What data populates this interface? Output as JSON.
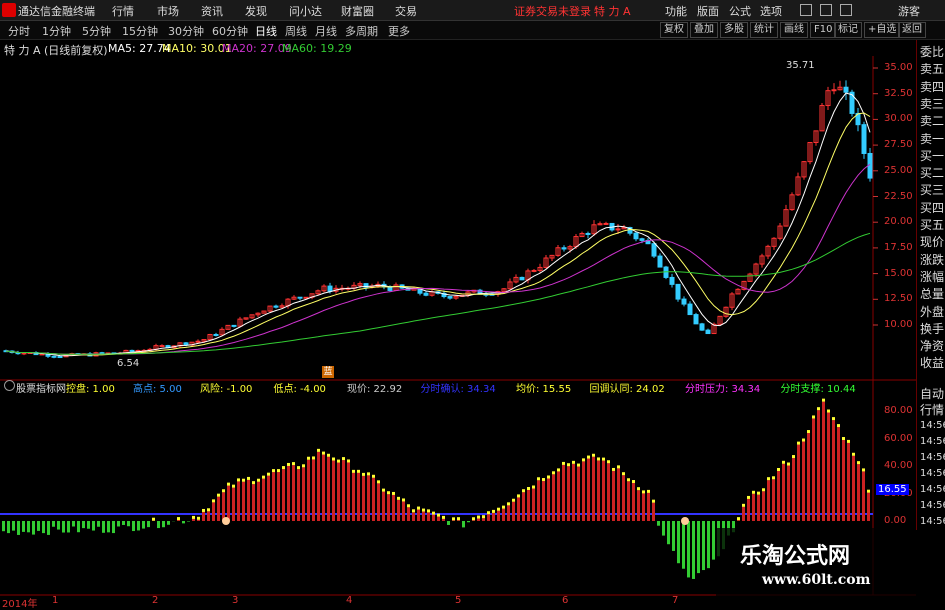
{
  "menubar": {
    "app_title": "通达信金融终端",
    "items": [
      "行情",
      "市场",
      "资讯",
      "发现",
      "问小达",
      "财富圈",
      "交易"
    ],
    "login_status": "证券交易未登录",
    "stock_name": "特 力 A",
    "right_items": [
      "功能",
      "版面",
      "公式",
      "选项"
    ],
    "guest": "游客"
  },
  "periodbar": {
    "periods": [
      "分时",
      "1分钟",
      "5分钟",
      "15分钟",
      "30分钟",
      "60分钟",
      "日线",
      "周线",
      "月线",
      "多周期",
      "更多"
    ],
    "active": "日线",
    "tools": [
      "复权",
      "叠加",
      "多股",
      "统计",
      "画线",
      "F10",
      "标记",
      "+自选",
      "返回"
    ]
  },
  "main_info": {
    "title": "特 力 A (日线前复权)",
    "ma5": "MA5: 27.74",
    "ma10": "MA10: 30.01",
    "ma20": "MA20: 27.09",
    "ma60": "MA60: 19.29"
  },
  "price_axis": [
    "35.00",
    "32.50",
    "30.00",
    "27.50",
    "25.00",
    "22.50",
    "20.00",
    "17.50",
    "15.00",
    "12.50",
    "10.00"
  ],
  "annotations": {
    "high": "35.71",
    "low": "6.54",
    "marker": "蓝"
  },
  "indicator_info": {
    "name": "股票指标网",
    "items": [
      {
        "label": "控盘:",
        "value": "1.00",
        "color": "#ffff33"
      },
      {
        "label": "高点:",
        "value": "5.00",
        "color": "#3399ff"
      },
      {
        "label": "风险:",
        "value": "-1.00",
        "color": "#ffff33"
      },
      {
        "label": "低点:",
        "value": "-4.00",
        "color": "#ffff33"
      },
      {
        "label": "现价:",
        "value": "22.92",
        "color": "#cccccc"
      },
      {
        "label": "分时确认:",
        "value": "34.34",
        "color": "#3333ff"
      },
      {
        "label": "均价:",
        "value": "15.55",
        "color": "#ffff33"
      },
      {
        "label": "回调认同:",
        "value": "24.02",
        "color": "#ffff33"
      },
      {
        "label": "分时压力:",
        "value": "34.34",
        "color": "#ff33ff"
      },
      {
        "label": "分时支撑:",
        "value": "10.44",
        "color": "#33ff33"
      }
    ]
  },
  "indicator_axis": [
    "80.00",
    "60.00",
    "40.00",
    "20.00",
    "0.00"
  ],
  "indicator_current": "16.55",
  "right_panel": [
    "委比",
    "卖五",
    "卖四",
    "卖三",
    "卖二",
    "卖一",
    "买一",
    "买二",
    "买三",
    "买四",
    "买五",
    "现价",
    "涨跌",
    "涨幅",
    "总量",
    "外盘",
    "换手",
    "净资",
    "收益"
  ],
  "right_panel2": [
    "自动",
    "行情",
    "14:56",
    "14:56",
    "14:56",
    "14:56",
    "14:56",
    "14:56",
    "14:56"
  ],
  "date_axis": [
    "2014年",
    "1",
    "2",
    "3",
    "4",
    "5",
    "6",
    "7"
  ],
  "watermark": {
    "line1": "乐淘公式网",
    "line2": "www.60lt.com"
  },
  "colors": {
    "up": "#ff3333",
    "down": "#33ccff",
    "ma5": "#ffffff",
    "ma10": "#ffff66",
    "ma20": "#cc33cc",
    "ma60": "#33cc33",
    "ind_up": "#cc2222",
    "ind_down": "#33cc33",
    "ind_top": "#ffff33"
  }
}
